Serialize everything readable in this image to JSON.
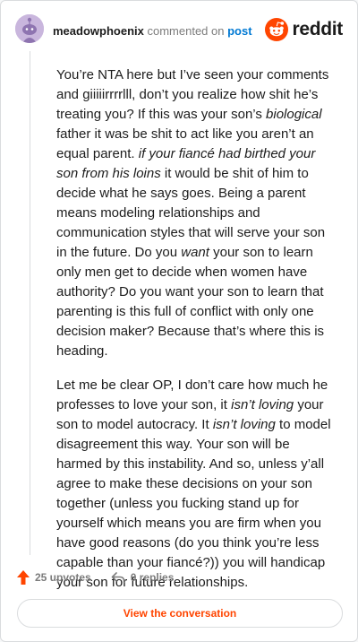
{
  "header": {
    "author": "meadowphoenix",
    "commented_text": "commented on",
    "post_link": "post",
    "logo_text": "reddit"
  },
  "comment": {
    "p1": [
      "You’re NTA here but I’ve seen your comments and giiiiirrrrlll, don’t you realize how shit he’s treating you? If this was your son’s ",
      "biological",
      " father it was be shit to act like you aren’t an equal parent. ",
      "if your fiancé had birthed your son from his loins",
      " it would be shit of him to decide what he says goes. Being a parent means modeling relationships and communication styles that will serve your son in the future. Do you ",
      "want",
      " your son to learn only men get to decide when women have authority? Do you want your son to learn that parenting is this full of conflict with only one decision maker? Because that’s where this is heading."
    ],
    "p2": [
      "Let me be clear OP, I don’t care how much he professes to love your son, it ",
      "isn’t loving",
      " your son to model autocracy. It ",
      "isn’t loving",
      " to model disagreement this way. Your son will be harmed by this instability. And so, unless y’all agree to make these decisions on your son together (unless you fucking stand up for yourself which means you are firm when you have good reasons (do you think you’re less capable than your fiancé?)) you will handicap your son for future relationships."
    ]
  },
  "footer": {
    "upvotes": "25 upvotes",
    "replies": "0 replies",
    "view_button": "View the conversation"
  },
  "colors": {
    "reddit_orange": "#ff4500",
    "link_blue": "#0079d3",
    "muted_gray": "#7c7c7c"
  }
}
